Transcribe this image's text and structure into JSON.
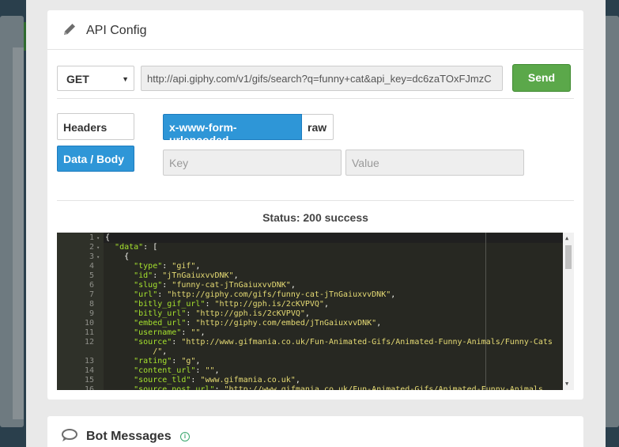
{
  "api_panel": {
    "title": "API Config",
    "method": "GET",
    "url": "http://api.giphy.com/v1/gifs/search?q=funny+cat&api_key=dc6zaTOxFJmzC",
    "send_label": "Send",
    "side_tabs": [
      "Headers",
      "Data / Body"
    ],
    "active_side_tab": "Data / Body",
    "body_formats": [
      "x-www-form-urlencoded",
      "raw"
    ],
    "active_body_format": "x-www-form-urlencoded",
    "key_placeholder": "Key",
    "value_placeholder": "Value",
    "status_text": "Status: 200 success"
  },
  "editor": {
    "lines": [
      {
        "n": "1",
        "fold": "▾",
        "text": "{"
      },
      {
        "n": "2",
        "fold": "▾",
        "text": "  \"data\": ["
      },
      {
        "n": "3",
        "fold": "▾",
        "text": "    {"
      },
      {
        "n": "4",
        "fold": "",
        "text": "      \"type\": \"gif\","
      },
      {
        "n": "5",
        "fold": "",
        "text": "      \"id\": \"jTnGaiuxvvDNK\","
      },
      {
        "n": "6",
        "fold": "",
        "text": "      \"slug\": \"funny-cat-jTnGaiuxvvDNK\","
      },
      {
        "n": "7",
        "fold": "",
        "text": "      \"url\": \"http://giphy.com/gifs/funny-cat-jTnGaiuxvvDNK\","
      },
      {
        "n": "8",
        "fold": "",
        "text": "      \"bitly_gif_url\": \"http://gph.is/2cKVPVQ\","
      },
      {
        "n": "9",
        "fold": "",
        "text": "      \"bitly_url\": \"http://gph.is/2cKVPVQ\","
      },
      {
        "n": "10",
        "fold": "",
        "text": "      \"embed_url\": \"http://giphy.com/embed/jTnGaiuxvvDNK\","
      },
      {
        "n": "11",
        "fold": "",
        "text": "      \"username\": \"\","
      },
      {
        "n": "12",
        "fold": "",
        "text": "      \"source\": \"http://www.gifmania.co.uk/Fun-Animated-Gifs/Animated-Funny-Animals/Funny-Cats"
      },
      {
        "n": "",
        "fold": "",
        "text": "          /\","
      },
      {
        "n": "13",
        "fold": "",
        "text": "      \"rating\": \"g\","
      },
      {
        "n": "14",
        "fold": "",
        "text": "      \"content_url\": \"\","
      },
      {
        "n": "15",
        "fold": "",
        "text": "      \"source_tld\": \"www.gifmania.co.uk\","
      },
      {
        "n": "16",
        "fold": "",
        "text": "      \"source_post_url\": \"http://www.gifmania.co.uk/Fun-Animated-Gifs/Animated-Funny-Animals"
      }
    ]
  },
  "bot_panel": {
    "title": "Bot Messages",
    "info_icon": "i"
  },
  "colors": {
    "send": "#5ba84a",
    "active_tab": "#2e96d7",
    "editor_bg": "#272822",
    "json_key": "#a6e22e",
    "json_string": "#e6db74"
  },
  "icons": {
    "api_panel": "pencil-icon",
    "bot_panel": "speech-bubble-icon"
  }
}
